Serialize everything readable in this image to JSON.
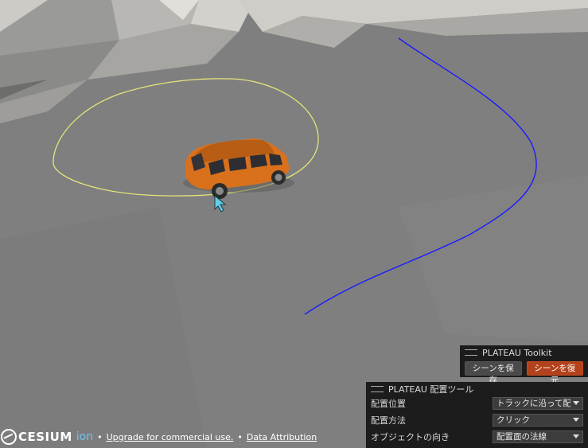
{
  "toolkit_panel": {
    "title": "PLATEAU Toolkit",
    "save_button": "シーンを保存",
    "restore_button": "シーンを復元"
  },
  "placement_panel": {
    "title": "PLATEAU 配置ツール",
    "rows": [
      {
        "label": "配置位置",
        "value": "トラックに沿って配置"
      },
      {
        "label": "配置方法",
        "value": "クリック"
      },
      {
        "label": "オブジェクトの向き",
        "value": "配置面の法線"
      }
    ]
  },
  "credits": {
    "logo_text": "CESIUM",
    "logo_suffix": "ion",
    "separator": "•",
    "upgrade_link": "Upgrade for commercial use.",
    "attribution_link": "Data Attribution"
  },
  "colors": {
    "track_spline": "#1a1aff",
    "selection_ring": "#e6e67a",
    "car_body": "#d9711c",
    "restore_accent": "#b3421c",
    "ion_text": "#6fc3ea"
  },
  "icons": [
    "cursor-arrow-icon",
    "cesium-logo-icon",
    "panel-grip-icon",
    "dropdown-caret-icon"
  ]
}
